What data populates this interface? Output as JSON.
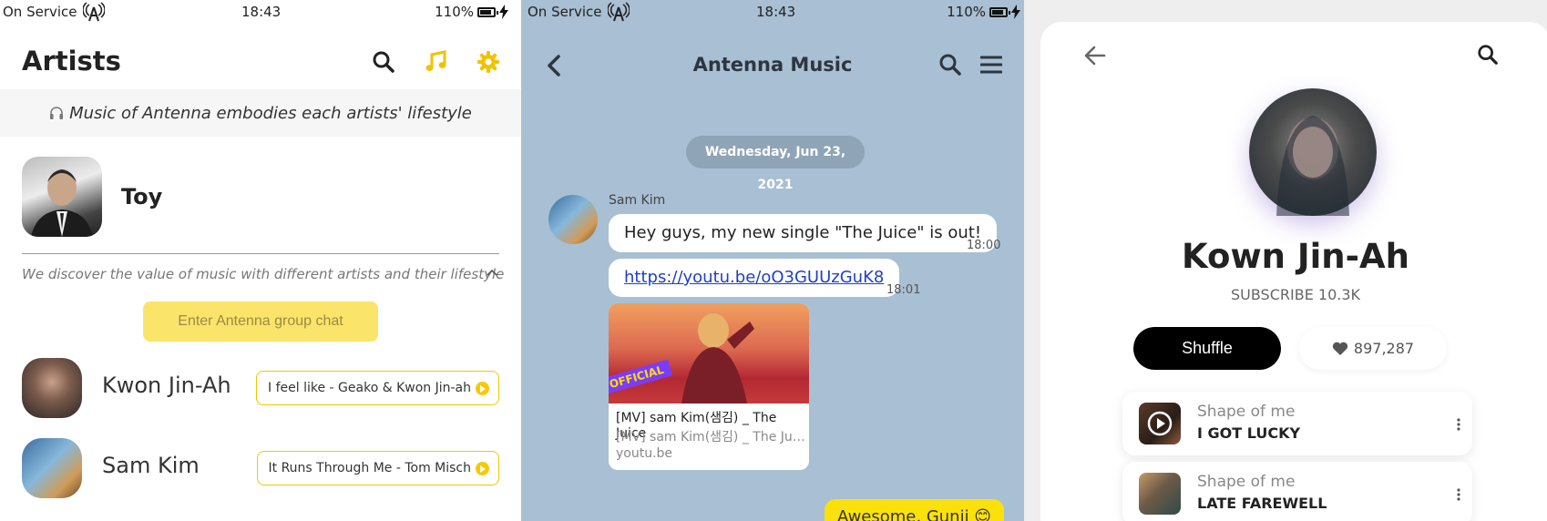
{
  "status_bar": {
    "carrier": "On Service",
    "time": "18:43",
    "battery": "110%"
  },
  "artists_screen": {
    "title": "Artists",
    "banner": "Music of Antenna embodies each artists' lifestyle",
    "featured": {
      "name": "Toy",
      "description": "We discover the value of music with different artists and their lifestyle"
    },
    "group_chat_button": "Enter Antenna group chat",
    "artists": [
      {
        "name": "Kwon Jin-Ah",
        "song": "I feel like - Geako & Kwon Jin-ah"
      },
      {
        "name": "Sam Kim",
        "song": "It Runs Through Me - Tom Misch"
      }
    ]
  },
  "chat_screen": {
    "title": "Antenna Music",
    "date": "Wednesday, Jun 23, 2021",
    "sender": "Sam Kim",
    "messages": [
      {
        "text": "Hey guys, my new single \"The Juice\" is out!",
        "time": "18:00"
      },
      {
        "text": "https://youtu.be/oO3GUUzGuK8",
        "time": "18:01"
      }
    ],
    "link_card": {
      "thumb_badge": "OFFICIAL",
      "title": "[MV] sam Kim(샘김) _ The Juice",
      "subtitle": "[MV] sam Kim(샘김) _ The Juice",
      "domain": "youtu.be"
    },
    "reply": "Awesome, Gunji 😊"
  },
  "profile_screen": {
    "name": "Kown Jin-Ah",
    "subscribers": "SUBSCRIBE 10.3K",
    "shuffle_label": "Shuffle",
    "likes": "897,287",
    "tracks": [
      {
        "album": "Shape of me",
        "title": "I GOT LUCKY"
      },
      {
        "album": "Shape of me",
        "title": "LATE FAREWELL"
      }
    ]
  },
  "colors": {
    "accent_yellow": "#f7c900",
    "chat_background": "#a9bfd3",
    "reply_bubble": "#fbe10c"
  }
}
